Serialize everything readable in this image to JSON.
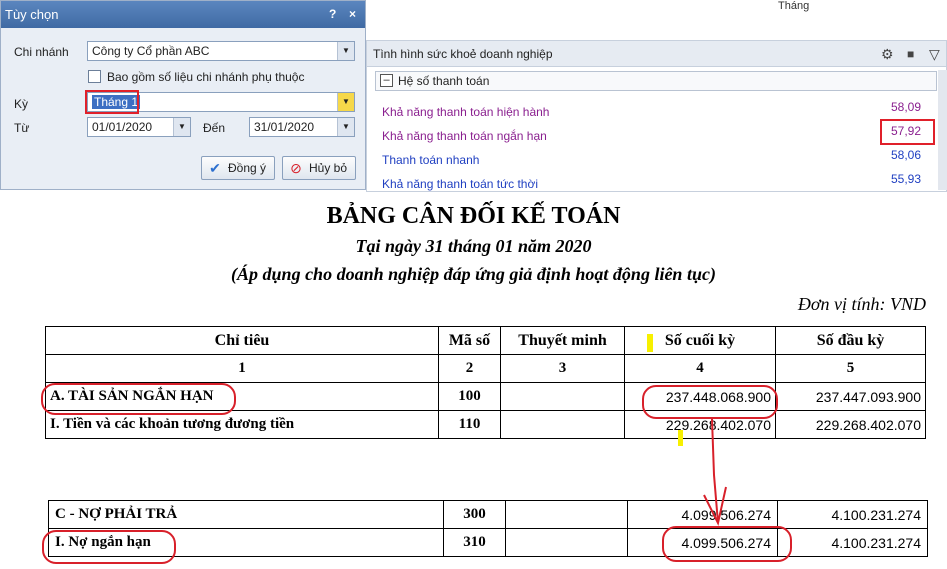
{
  "dialog": {
    "title": "Tùy chọn",
    "help_glyph": "?",
    "close_glyph": "×",
    "branch_label": "Chi nhánh",
    "branch_value": "Công ty Cổ phần ABC",
    "include_sub_label": "Bao gồm số liệu chi nhánh phụ thuộc",
    "period_label": "Kỳ",
    "period_value": "Tháng 1",
    "from_label": "Từ",
    "from_value": "01/01/2020",
    "to_label": "Đến",
    "to_value": "31/01/2020",
    "ok_label": "Đồng ý",
    "cancel_label": "Hủy bỏ"
  },
  "top_strip": {
    "text": "Tháng"
  },
  "panel": {
    "title": "Tình hình sức khoẻ doanh nghiệp",
    "group_label": "Hệ số thanh toán",
    "minus_glyph": "–",
    "items": [
      {
        "label": "Khả năng thanh toán hiện hành",
        "value": "58,09",
        "color": "#8a1f8f"
      },
      {
        "label": "Khả năng thanh toán ngắn hạn",
        "value": "57,92",
        "color": "#8a1f8f"
      },
      {
        "label": "Thanh toán nhanh",
        "value": "58,06",
        "color": "#1f3fc1"
      },
      {
        "label": "Khả năng thanh toán tức thời",
        "value": "55,93",
        "color": "#1f3fc1"
      }
    ]
  },
  "report": {
    "title": "BẢNG CÂN ĐỐI KẾ TOÁN",
    "subtitle": "Tại ngày 31 tháng 01 năm 2020",
    "note": "(Áp dụng cho doanh nghiệp đáp ứng giả định hoạt động liên tục)",
    "unit": "Đơn vị tính: VND",
    "headers": [
      "Chỉ tiêu",
      "Mã số",
      "Thuyết minh",
      "Số cuối kỳ",
      "Số đầu kỳ"
    ],
    "numbers": [
      "1",
      "2",
      "3",
      "4",
      "5"
    ],
    "rows": [
      {
        "name": "A. TÀI SẢN NGẮN HẠN",
        "code": "100",
        "note": "",
        "end": "237.448.068.900",
        "start": "237.447.093.900"
      },
      {
        "name": "I. Tiền và các khoản tương đương tiền",
        "code": "110",
        "note": "",
        "end": "229.268.402.070",
        "start": "229.268.402.070"
      }
    ],
    "rows2": [
      {
        "name": "C - NỢ PHẢI TRẢ",
        "code": "300",
        "note": "",
        "end": "4.099.506.274",
        "start": "4.100.231.274"
      },
      {
        "name": "I. Nợ ngắn hạn",
        "code": "310",
        "note": "",
        "end": "4.099.506.274",
        "start": "4.100.231.274"
      }
    ]
  },
  "colors": {
    "highlight_red": "#e0202a",
    "accent_blue": "#3f6aa4"
  }
}
